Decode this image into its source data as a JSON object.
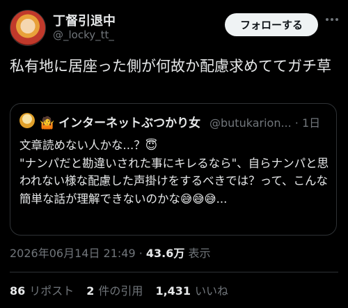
{
  "author": {
    "name": "丁督引退中",
    "handle": "@_locky_tt_"
  },
  "follow_label": "フォローする",
  "tweet_text": "私有地に居座った側が何故か配慮求めててガチ草",
  "quote": {
    "name": "🤷 インターネットぶつかり女",
    "handle": "@butukarion... · 1日",
    "text": "文章読めない人かな...？😇\n\"ナンパだと勘違いされた事にキレるなら\"、自らナンパと思われない様な配慮した声掛けをするべきでは？って、こんな簡単な話が理解できないのかな😅😅😅..."
  },
  "meta": {
    "timestamp": "2026年06月14日 21:49 · ",
    "views": "43.6万",
    "views_label": " 表示"
  },
  "stats": {
    "reposts_count": "86",
    "reposts_label": "リポスト",
    "quotes_count": "2",
    "quotes_label": "件の引用",
    "likes_count": "1,431",
    "likes_label": "いいね"
  }
}
